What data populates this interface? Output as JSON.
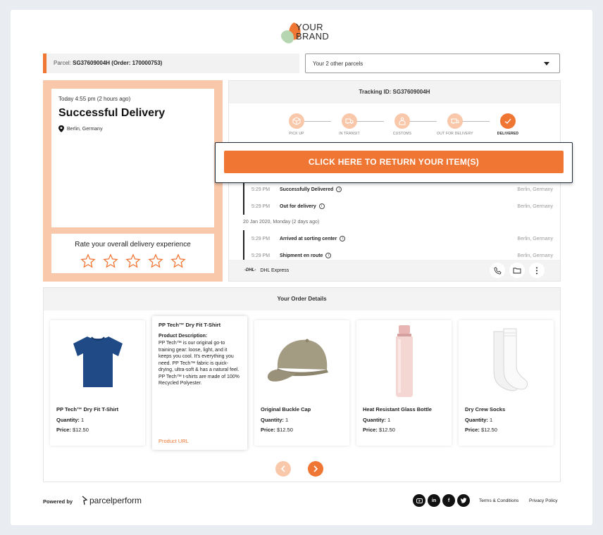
{
  "brand": {
    "line1": "YOUR",
    "line2": "BRAND"
  },
  "parcel": {
    "label": "Parcel: ",
    "value": "SG37609004H (Order: 170000753)"
  },
  "other_parcels": {
    "label": "Your 2 other parcels"
  },
  "status": {
    "time": "Today 4:55 pm (2 hours ago)",
    "title": "Successful Delivery",
    "location": "Berlin, Germany"
  },
  "rating": {
    "label": "Rate your overall delivery experience",
    "stars": 5
  },
  "tracking": {
    "title": "Tracking ID: SG37609004H",
    "steps": [
      {
        "label": "PICK UP"
      },
      {
        "label": "IN TRANSIT"
      },
      {
        "label": "CUSTOMS"
      },
      {
        "label": "OUT FOR DELIVERY"
      },
      {
        "label": "DELIVERED"
      }
    ],
    "events_today": [
      {
        "time": "5:29 PM",
        "desc": "Successfully Delivered",
        "loc": "Berlin, Germany"
      },
      {
        "time": "5:29 PM",
        "desc": "Out for delivery",
        "loc": "Berlin, Germany"
      }
    ],
    "date_label": "20 Jan 2020, Monday (2 days ago)",
    "events_earlier": [
      {
        "time": "5:29 PM",
        "desc": "Arrived at sorting center",
        "loc": "Berlin, Germany"
      },
      {
        "time": "5:29 PM",
        "desc": "Shipment en route",
        "loc": "Berlin, Germany"
      }
    ],
    "carrier_logo": "-DHL-",
    "carrier": "DHL Express"
  },
  "cta": {
    "label": "CLICK HERE TO RETURN YOUR ITEM(S)"
  },
  "orders": {
    "title": "Your Order Details",
    "quantity_label": "Quantity:",
    "price_label": "Price:",
    "products": [
      {
        "name": "PP Tech™ Dry Fit T-Shirt",
        "qty": "1",
        "price": "$12.50"
      },
      {
        "name": "Original Buckle Cap",
        "qty": "1",
        "price": "$12.50"
      },
      {
        "name": "Heat Resistant Glass Bottle",
        "qty": "1",
        "price": "$12.50"
      },
      {
        "name": "Dry Crew Socks",
        "qty": "1",
        "price": "$12.50"
      }
    ],
    "description": {
      "name": "PP Tech™ Dry Fit T-Shirt",
      "heading": "Product Description:",
      "text": "PP Tech™ is our original go-to training gear: loose, light, and it keeps you cool. It's everything you need. PP Tech™ fabric is quick-drying, ultra-soft & has a natural feel. PP Tech™ t-shirts are made of 100% Recycled Polyester.",
      "url_label": "Product URL"
    }
  },
  "footer": {
    "powered_by": "Powered by",
    "company": "parcelperform",
    "social": [
      "youtube",
      "linkedin",
      "facebook",
      "twitter"
    ],
    "terms": "Terms & Conditions",
    "privacy": "Privacy Policy"
  },
  "colors": {
    "accent": "#f07633",
    "accent_light": "#f9c8aa"
  }
}
